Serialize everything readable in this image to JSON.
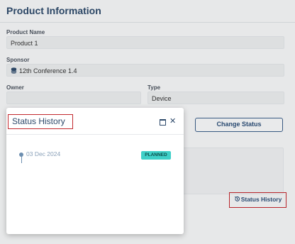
{
  "page": {
    "title": "Product Information",
    "product_name": {
      "label": "Product Name",
      "value": "Product 1"
    },
    "sponsor": {
      "label": "Sponsor",
      "value": "12th Conference 1.4",
      "icon": "database-icon"
    },
    "owner": {
      "label": "Owner",
      "value": ""
    },
    "type": {
      "label": "Type",
      "value": "Device"
    },
    "change_status_label": "Change Status",
    "status_history_label": "Status History",
    "status_history_icon": "history-icon"
  },
  "dialog": {
    "title": "Status History",
    "maximize_icon": "maximize-icon",
    "close_icon": "close-icon",
    "close_glyph": "✕",
    "entries": [
      {
        "date": "03 Dec 2024",
        "status": "PLANNED",
        "status_color": "#3fd0c8"
      }
    ]
  },
  "colors": {
    "accent": "#2e4a6b",
    "highlight_border": "#c2282e",
    "badge": "#3fd0c8"
  }
}
